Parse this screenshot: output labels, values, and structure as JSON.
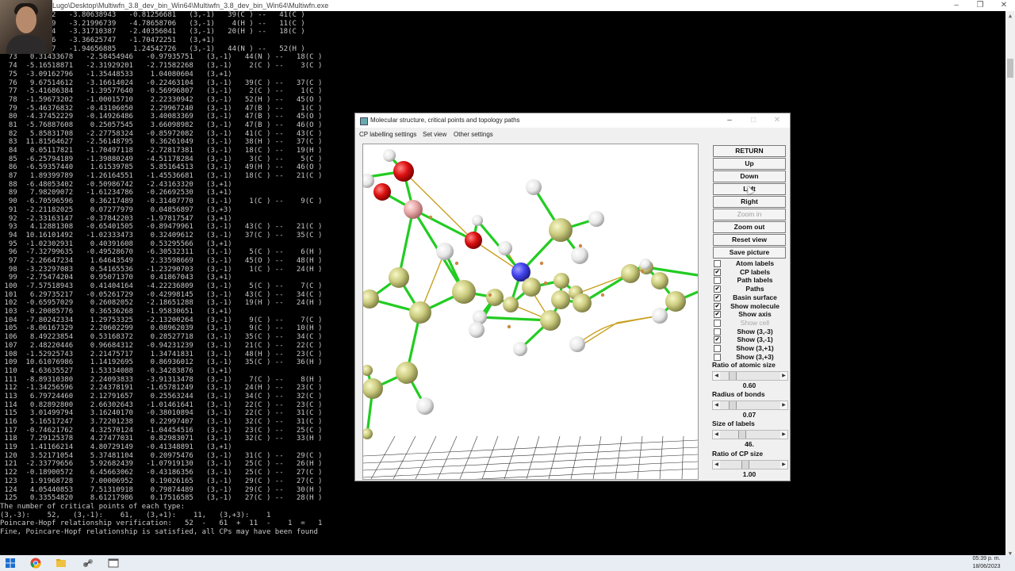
{
  "console": {
    "title": "Lugo\\Desktop\\Multiwfn_3.8_dev_bin_Win64\\Multiwfn_3.8_dev_bin_Win64\\Multiwfn.exe",
    "lines": [
      "      6056742   -3.80638943   -0.81256681   (3,-1)   39(C ) --   41(C )",
      "      1052709   -3.21996739   -4.78658706   (3,-1)    4(H ) --   11(C )",
      "      4932184   -3.31710387   -2.40356041   (3,-1)   20(H ) --   18(C )",
      "      7537326   -3.36625747   -1.70472251   (3,+1)",
      "      0717047   -1.94656885    1.24542726   (3,-1)   44(N ) --   52(H )",
      "  73   0.31433678   -2.58454946   -0.97935751   (3,-1)   44(N ) --   18(C )",
      "  74  -5.16518871   -2.31929201   -2.71582268   (3,-1)    2(C ) --    3(C )",
      "  75  -3.09162796   -1.35448533    1.04080604   (3,+1)",
      "  76   9.67514612   -3.16614024   -0.22463104   (3,-1)   39(C ) --   37(C )",
      "  77  -5.41686384   -1.39577640   -0.56996807   (3,-1)    2(C ) --    1(C )",
      "  78  -1.59673202   -1.00015710    2.22330942   (3,-1)   52(H ) --   45(O )",
      "  79  -5.46376832   -0.43106050    2.29967240   (3,-1)   47(B ) --    1(C )",
      "  80  -4.37452229   -0.14926486    3.40083369   (3,-1)   47(B ) --   45(O )",
      "  81  -5.76887608    0.25057545    3.66098982   (3,-1)   47(B ) --   46(O )",
      "  82   5.85831708   -2.27758324   -0.85972082   (3,-1)   41(C ) --   43(C )",
      "  83  11.81564627   -2.56148795    0.36261049   (3,-1)   38(H ) --   37(C )",
      "  84   0.05117821   -1.70497118   -2.72817381   (3,-1)   18(C ) --   19(H )",
      "  85  -6.25794189   -1.39880249   -4.51178284   (3,-1)    3(C ) --    5(C )",
      "  86  -6.59357440    1.61539785    5.85164513   (3,-1)   49(H ) --   46(O )",
      "  87   1.89399789   -1.26164551   -1.45536681   (3,-1)   18(C ) --   21(C )",
      "  88  -6.48053402   -0.50986742   -2.43163320   (3,+1)",
      "  89   7.98209072   -1.61234786   -0.26692530   (3,+1)",
      "  90  -6.70596596    0.36217489   -0.31407770   (3,-1)    1(C ) --    9(C )",
      "  91  -2.21182025    0.07277979    0.04856897   (3,+3)",
      "  92  -2.33163147   -0.37842203   -1.97817547   (3,+1)",
      "  93   4.12881308   -0.65401505   -0.89479961   (3,-1)   43(C ) --   21(C )",
      "  94  10.16101492   -1.02333473    0.32409612   (3,-1)   37(C ) --   35(C )",
      "  95  -1.02302931    0.40391608    0.53295566   (3,+1)",
      "  96  -7.32799635   -0.49528670   -6.30532311   (3,-1)    5(C ) --    6(H )",
      "  97  -2.26647234    1.64643549    2.33598669   (3,-1)   45(O ) --   48(H )",
      "  98  -3.23297083    0.54165536   -1.23290703   (3,-1)    1(C ) --   24(H )",
      "  99  -2.75474204    0.95071370    0.41867043   (3,+1)",
      " 100  -7.57518943    0.41404164   -4.22236809   (3,-1)    5(C ) --    7(C )",
      " 101   6.29735217   -0.05261729   -0.42998145   (3,-1)   43(C ) --   34(C )",
      " 102  -0.65957029    0.26082052   -2.18651288   (3,-1)   19(H ) --   24(H )",
      " 103  -0.20085776    0.36536268   -1.95830651   (3,+1)",
      " 104  -7.80242334    1.29753325   -2.13200264   (3,-1)    9(C ) --    7(C )",
      " 105  -8.06167329    2.20602299    0.08962039   (3,-1)    9(C ) --   10(H )",
      " 106   8.49223854    0.53168372    0.28527718   (3,-1)   35(C ) --   34(C )",
      " 107   2.48220446    0.96684312   -0.94231239   (3,-1)   21(C ) --   22(C )",
      " 108  -1.52925743    2.21475717    1.34741831   (3,-1)   48(H ) --   23(C )",
      " 109  10.61076986    1.14192695    0.86936012   (3,-1)   35(C ) --   36(H )",
      " 110   4.63635527    1.53334088   -0.34283876   (3,+1)",
      " 111  -8.89310380    2.24093833   -3.91313478   (3,-1)    7(C ) --    8(H )",
      " 112  -1.34256596    2.24378191   -1.65781249   (3,-1)   24(H ) --   23(C )",
      " 113   6.79724460    2.12791657    0.25563244   (3,-1)   34(C ) --   32(C )",
      " 114   0.82892800    2.66302643   -1.01461641   (3,-1)   22(C ) --   23(C )",
      " 115   3.01499794    3.16240170   -0.38010894   (3,-1)   22(C ) --   31(C )",
      " 116   5.16517247    3.72201238    0.22997407   (3,-1)   32(C ) --   31(C )",
      " 117  -0.74621762    4.32570124   -1.04454516   (3,-1)   23(C ) --   25(C )",
      " 118   7.29125378    4.27477031    0.82983071   (3,-1)   32(C ) --   33(H )",
      " 119   1.41166214    4.80729149   -0.41348891   (3,+1)",
      " 120   3.52171054    5.37481104    0.20975476   (3,-1)   31(C ) --   29(C )",
      " 121  -2.33779656    5.92682439   -1.07919130   (3,-1)   25(C ) --   26(H )",
      " 122  -0.18900572    6.45663062   -0.43186356   (3,-1)   25(C ) --   27(C )",
      " 123   1.91968728    7.00006952    0.19026165   (3,-1)   29(C ) --   27(C )",
      " 124   4.05440853    7.51310918    0.79874489   (3,-1)   29(C ) --   30(H )",
      " 125   0.33554820    8.61217986    0.17516585   (3,-1)   27(C ) --   28(H )",
      "The number of critical points of each type:",
      "(3,-3):    52,   (3,-1):    61,   (3,+1):    11,   (3,+3):    1",
      "Poincare-Hopf relationship verification:   52  -   61  +  11  -    1  =   1",
      "Fine, Poincare-Hopf relationship is satisfied, all CPs may have been found"
    ]
  },
  "dialog": {
    "title": "Molecular structure, critical points and topology paths",
    "menu": [
      "CP labelling settings",
      "Set view",
      "Other settings"
    ],
    "buttons": [
      {
        "label": "RETURN",
        "enabled": true
      },
      {
        "label": "Up",
        "enabled": true
      },
      {
        "label": "Down",
        "enabled": true
      },
      {
        "label": "Left",
        "enabled": true
      },
      {
        "label": "Right",
        "enabled": true
      },
      {
        "label": "Zoom in",
        "enabled": false
      },
      {
        "label": "Zoom out",
        "enabled": true
      },
      {
        "label": "Reset view",
        "enabled": true
      },
      {
        "label": "Save picture",
        "enabled": true
      }
    ],
    "checkboxes": [
      {
        "label": "Atom labels",
        "checked": false,
        "enabled": true
      },
      {
        "label": "CP labels",
        "checked": true,
        "enabled": true
      },
      {
        "label": "Path labels",
        "checked": false,
        "enabled": true
      },
      {
        "label": "Paths",
        "checked": true,
        "enabled": true
      },
      {
        "label": "Basin surface",
        "checked": true,
        "enabled": true
      },
      {
        "label": "Show molecule",
        "checked": true,
        "enabled": true
      },
      {
        "label": "Show axis",
        "checked": true,
        "enabled": true
      },
      {
        "label": "Show cell",
        "checked": false,
        "enabled": false
      },
      {
        "label": "Show (3,-3)",
        "checked": false,
        "enabled": true
      },
      {
        "label": "Show (3,-1)",
        "checked": true,
        "enabled": true
      },
      {
        "label": "Show (3,+1)",
        "checked": false,
        "enabled": true
      },
      {
        "label": "Show (3,+3)",
        "checked": false,
        "enabled": true
      }
    ],
    "sliders": [
      {
        "label": "Ratio of atomic size",
        "value": "0.60",
        "position": 0.15
      },
      {
        "label": "Radius of bonds",
        "value": "0.07",
        "position": 0.15
      },
      {
        "label": "Size of labels",
        "value": "46.",
        "position": 0.33
      },
      {
        "label": "Ratio of CP size",
        "value": "1.00",
        "position": 0.4
      }
    ]
  },
  "taskbar": {
    "time": "05:39 p. m.",
    "date": "18/06/2023"
  },
  "colors": {
    "bond": "#22cc22",
    "path": "#c8a020",
    "carbon": "#cccc80",
    "hydrogen": "#f2f2f2",
    "oxygen": "#dd1111",
    "nitrogen": "#4444ee",
    "boron": "#e8a8a8"
  }
}
